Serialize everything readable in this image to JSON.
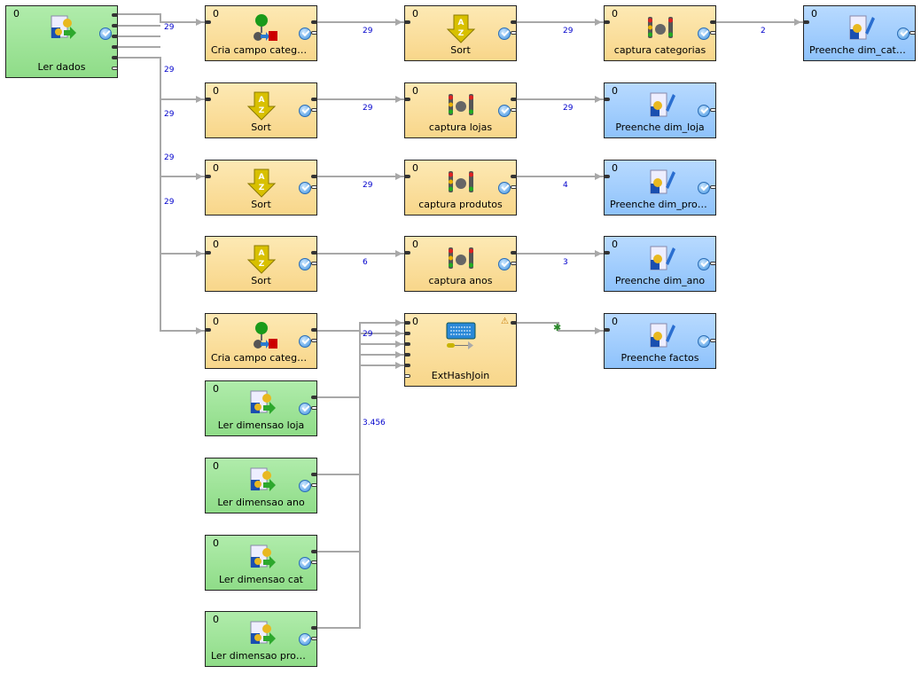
{
  "nodes": [
    {
      "id": "ler-dados",
      "label": "Ler dados",
      "phase": "0",
      "type": "reader",
      "icon": "reader-icon"
    },
    {
      "id": "cria1",
      "label": "Cria campo categoria",
      "phase": "0",
      "type": "transform",
      "icon": "reformat-icon"
    },
    {
      "id": "sort1",
      "label": "Sort",
      "phase": "0",
      "type": "transform",
      "icon": "sort-icon"
    },
    {
      "id": "capcat",
      "label": "captura categorias",
      "phase": "0",
      "type": "transform",
      "icon": "dedup-icon"
    },
    {
      "id": "dimcat",
      "label": "Preenche dim_categoria",
      "phase": "0",
      "type": "writer",
      "icon": "writer-icon"
    },
    {
      "id": "sort2",
      "label": "Sort",
      "phase": "0",
      "type": "transform",
      "icon": "sort-icon"
    },
    {
      "id": "caplojas",
      "label": "captura lojas",
      "phase": "0",
      "type": "transform",
      "icon": "dedup-icon"
    },
    {
      "id": "dimloja",
      "label": "Preenche dim_loja",
      "phase": "0",
      "type": "writer",
      "icon": "writer-icon"
    },
    {
      "id": "sort3",
      "label": "Sort",
      "phase": "0",
      "type": "transform",
      "icon": "sort-icon"
    },
    {
      "id": "capprod",
      "label": "captura produtos",
      "phase": "0",
      "type": "transform",
      "icon": "dedup-icon"
    },
    {
      "id": "dimprod",
      "label": "Preenche dim_produto",
      "phase": "0",
      "type": "writer",
      "icon": "writer-icon"
    },
    {
      "id": "sort4",
      "label": "Sort",
      "phase": "0",
      "type": "transform",
      "icon": "sort-icon"
    },
    {
      "id": "capanos",
      "label": "captura anos",
      "phase": "0",
      "type": "transform",
      "icon": "dedup-icon"
    },
    {
      "id": "dimano",
      "label": "Preenche dim_ano",
      "phase": "0",
      "type": "writer",
      "icon": "writer-icon"
    },
    {
      "id": "cria2",
      "label": "Cria campo categoria",
      "phase": "0",
      "type": "transform",
      "icon": "reformat-icon"
    },
    {
      "id": "join",
      "label": "ExtHashJoin",
      "phase": "0",
      "type": "transform",
      "icon": "join-icon",
      "warning": true
    },
    {
      "id": "factos",
      "label": "Preenche factos",
      "phase": "0",
      "type": "writer",
      "icon": "writer-icon"
    },
    {
      "id": "lerloja",
      "label": "Ler dimensao loja",
      "phase": "0",
      "type": "reader",
      "icon": "reader-icon"
    },
    {
      "id": "lerano",
      "label": "Ler dimensao ano",
      "phase": "0",
      "type": "reader",
      "icon": "reader-icon"
    },
    {
      "id": "lercat",
      "label": "Ler dimensao cat",
      "phase": "0",
      "type": "reader",
      "icon": "reader-icon"
    },
    {
      "id": "lerprod",
      "label": "Ler dimensao produto",
      "phase": "0",
      "type": "reader",
      "icon": "reader-icon"
    }
  ],
  "edge_labels": [
    "29",
    "29",
    "29",
    "29",
    "29",
    "29",
    "29",
    "29",
    "29",
    "29",
    "4",
    "6",
    "3",
    "2",
    "29",
    "3.456"
  ],
  "colors": {
    "reader": "#a0e49a",
    "transform": "#fbe0a0",
    "writer": "#a4cffd",
    "edge": "#a8a8a8",
    "edge_label": "#0000cc"
  }
}
